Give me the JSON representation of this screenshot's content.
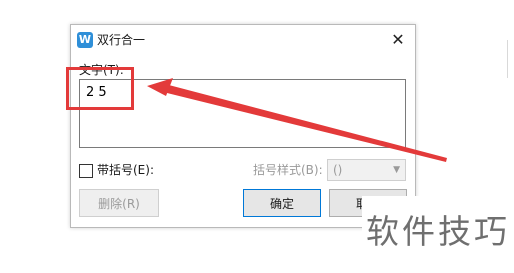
{
  "dialog": {
    "app_icon": "W",
    "title": "双行合一",
    "close_glyph": "✕",
    "text_label": "文字(T):",
    "text_value": "2 5",
    "checkbox_label": "带括号(E):",
    "bracket_style_label": "括号样式(B):",
    "bracket_style_value": "()",
    "delete_label": "删除(R)",
    "ok_label": "确定",
    "cancel_label": "取消"
  },
  "annotation": {
    "color": "#e33a3a",
    "watermark": "软件技巧"
  }
}
